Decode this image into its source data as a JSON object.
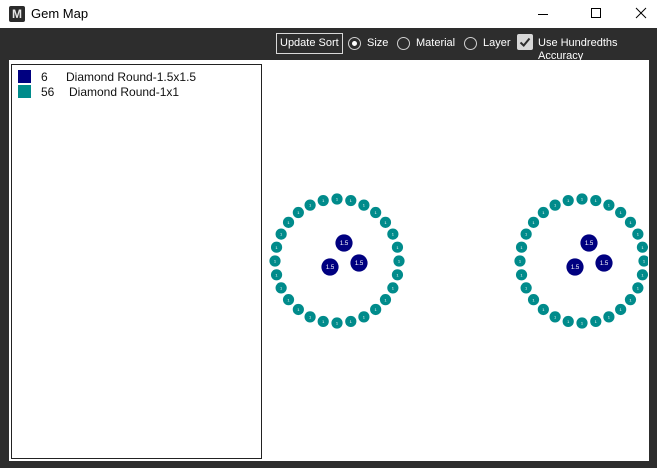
{
  "window": {
    "title": "Gem Map",
    "app_icon_letter": "M"
  },
  "toolbar": {
    "update_sort_label": "Update Sort",
    "sort_options": [
      {
        "label": "Size",
        "selected": true
      },
      {
        "label": "Material",
        "selected": false
      },
      {
        "label": "Layer",
        "selected": false
      }
    ],
    "hundredths_label": "Use Hundredths Accuracy",
    "hundredths_checked": true
  },
  "legend": {
    "items": [
      {
        "count": "6",
        "name": "Diamond Round-1.5x1.5",
        "color": "#000080"
      },
      {
        "count": "56",
        "name": "Diamond Round-1x1",
        "color": "#008b8b"
      }
    ]
  },
  "gem_map": {
    "clusters": [
      {
        "center_label": "1.5",
        "center_count": 3,
        "halo_label": "1",
        "halo_count": 28
      },
      {
        "center_label": "1.5",
        "center_count": 3,
        "halo_label": "1",
        "halo_count": 28
      }
    ]
  },
  "colors": {
    "toolbar_bg": "#2d2d2d",
    "center_stone": "#000080",
    "halo_stone": "#008b8b"
  }
}
